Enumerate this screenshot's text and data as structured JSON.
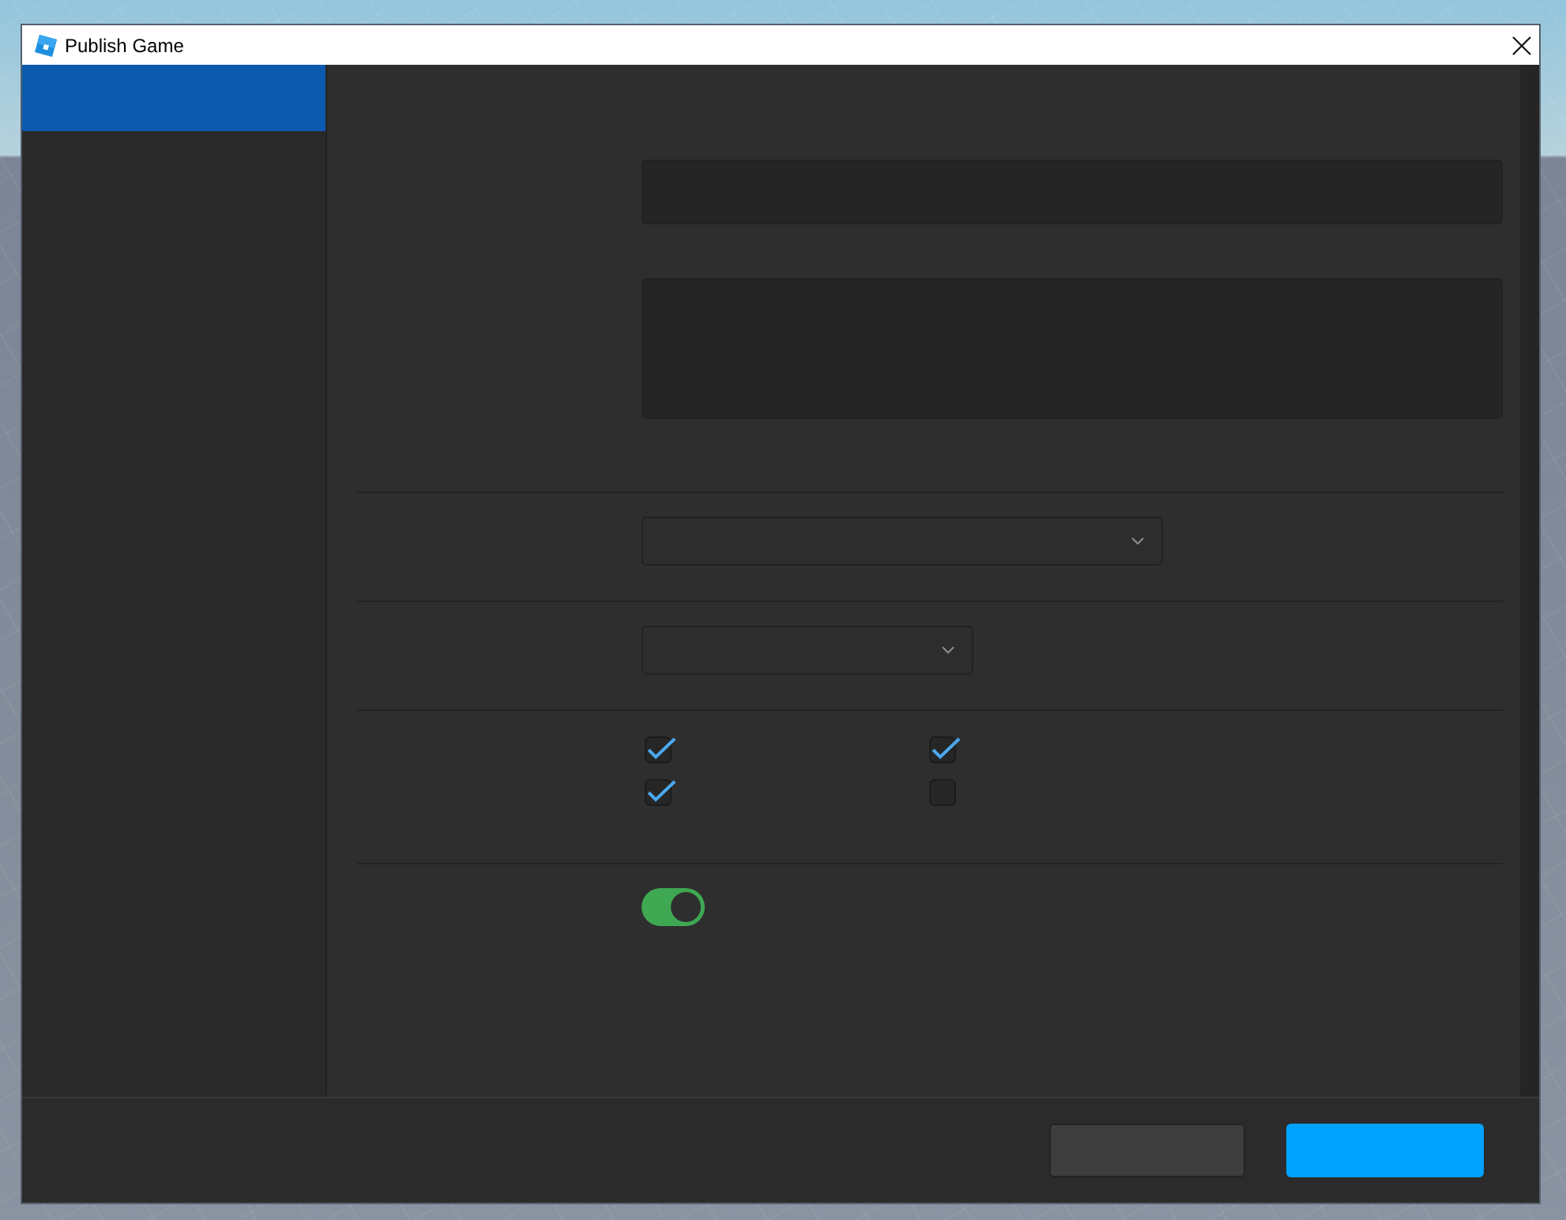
{
  "window": {
    "title": "Publish Game"
  },
  "sidebar": {
    "items": [
      {
        "selected": true
      }
    ]
  },
  "form": {
    "sections": [
      {
        "fields": [
          {
            "kind": "text_field"
          },
          {
            "kind": "text_area"
          }
        ]
      },
      {
        "fields": [
          {
            "kind": "dropdown"
          }
        ]
      },
      {
        "fields": [
          {
            "kind": "dropdown"
          }
        ]
      },
      {
        "fields": [
          {
            "kind": "checkboxes",
            "options": [
              {
                "checked": true
              },
              {
                "checked": true
              },
              {
                "checked": true
              },
              {
                "checked": false
              }
            ]
          }
        ]
      },
      {
        "fields": [
          {
            "kind": "toggle",
            "on": true
          }
        ]
      }
    ]
  },
  "footer": {
    "buttons": [
      {
        "kind": "secondary"
      },
      {
        "kind": "primary"
      }
    ]
  }
}
